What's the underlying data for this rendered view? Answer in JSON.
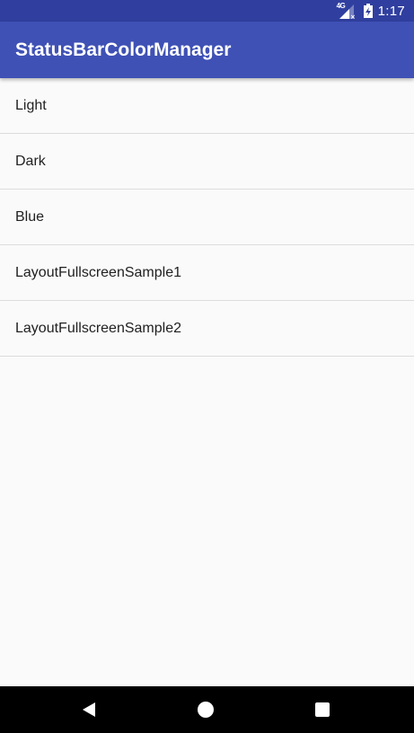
{
  "status_bar": {
    "network_type": "4G",
    "time": "1:17",
    "icons": [
      "signal-icon",
      "battery-icon"
    ]
  },
  "app_bar": {
    "title": "StatusBarColorManager"
  },
  "list": {
    "items": [
      {
        "label": "Light"
      },
      {
        "label": "Dark"
      },
      {
        "label": "Blue"
      },
      {
        "label": "LayoutFullscreenSample1"
      },
      {
        "label": "LayoutFullscreenSample2"
      }
    ]
  },
  "navigation": {
    "buttons": [
      "back-icon",
      "home-icon",
      "recents-icon"
    ]
  },
  "colors": {
    "primary": "#3f51b5",
    "primary_dark": "#303f9f",
    "background": "#fafafa",
    "divider": "#dcdcdc",
    "text": "#212121",
    "nav_bar": "#000000"
  }
}
